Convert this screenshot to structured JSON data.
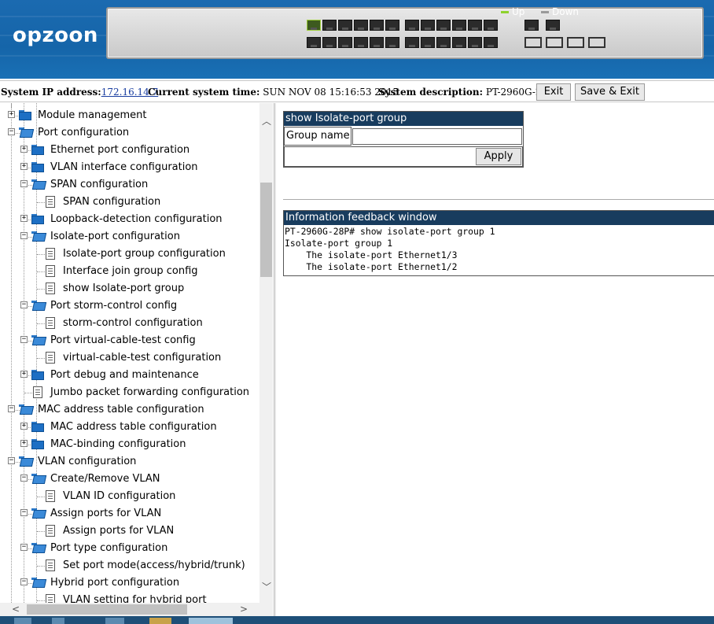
{
  "banner": {
    "logo": "opzoon",
    "legend_up": "Up",
    "legend_down": "Down",
    "up_color": "#8ed22c",
    "down_color": "#9a9a9a"
  },
  "infobar": {
    "ip_label": "System IP address:",
    "ip_value": "172.16.14.7",
    "time_label": "Current system time:",
    "time_value": "SUN NOV 08 15:16:53 2015",
    "desc_label": "System description:",
    "desc_value": "PT-2960G-28P",
    "exit_label": "Exit",
    "save_exit_label": "Save & Exit"
  },
  "tree": {
    "items": [
      {
        "label": "Module management",
        "level": 0,
        "type": "folder",
        "state": "collapsed"
      },
      {
        "label": "Port configuration",
        "level": 0,
        "type": "folder",
        "state": "expanded"
      },
      {
        "label": "Ethernet port configuration",
        "level": 1,
        "type": "folder",
        "state": "collapsed"
      },
      {
        "label": "VLAN interface configuration",
        "level": 1,
        "type": "folder",
        "state": "collapsed"
      },
      {
        "label": "SPAN configuration",
        "level": 1,
        "type": "folder",
        "state": "expanded"
      },
      {
        "label": "SPAN configuration",
        "level": 2,
        "type": "page"
      },
      {
        "label": "Loopback-detection configuration",
        "level": 1,
        "type": "folder",
        "state": "collapsed"
      },
      {
        "label": "Isolate-port configuration",
        "level": 1,
        "type": "folder",
        "state": "expanded"
      },
      {
        "label": "Isolate-port group configuration",
        "level": 2,
        "type": "page"
      },
      {
        "label": "Interface join group config",
        "level": 2,
        "type": "page"
      },
      {
        "label": "show Isolate-port group",
        "level": 2,
        "type": "page"
      },
      {
        "label": "Port storm-control config",
        "level": 1,
        "type": "folder",
        "state": "expanded"
      },
      {
        "label": "storm-control configuration",
        "level": 2,
        "type": "page"
      },
      {
        "label": "Port virtual-cable-test config",
        "level": 1,
        "type": "folder",
        "state": "expanded"
      },
      {
        "label": "virtual-cable-test configuration",
        "level": 2,
        "type": "page"
      },
      {
        "label": "Port debug and maintenance",
        "level": 1,
        "type": "folder",
        "state": "collapsed"
      },
      {
        "label": "Jumbo packet forwarding configuration",
        "level": 1,
        "type": "page"
      },
      {
        "label": "MAC address table configuration",
        "level": 0,
        "type": "folder",
        "state": "expanded"
      },
      {
        "label": "MAC address table configuration",
        "level": 1,
        "type": "folder",
        "state": "collapsed"
      },
      {
        "label": "MAC-binding configuration",
        "level": 1,
        "type": "folder",
        "state": "collapsed"
      },
      {
        "label": "VLAN configuration",
        "level": 0,
        "type": "folder",
        "state": "expanded"
      },
      {
        "label": "Create/Remove VLAN",
        "level": 1,
        "type": "folder",
        "state": "expanded"
      },
      {
        "label": "VLAN ID configuration",
        "level": 2,
        "type": "page"
      },
      {
        "label": "Assign ports for VLAN",
        "level": 1,
        "type": "folder",
        "state": "expanded"
      },
      {
        "label": "Assign ports for VLAN",
        "level": 2,
        "type": "page"
      },
      {
        "label": "Port type configuration",
        "level": 1,
        "type": "folder",
        "state": "expanded"
      },
      {
        "label": "Set port mode(access/hybrid/trunk)",
        "level": 2,
        "type": "page"
      },
      {
        "label": "Hybrid port configuration",
        "level": 1,
        "type": "folder",
        "state": "expanded"
      },
      {
        "label": "VLAN setting for hybrid port",
        "level": 2,
        "type": "page"
      }
    ]
  },
  "form": {
    "title": "show Isolate-port group",
    "group_name_label": "Group name",
    "group_name_value": "",
    "apply_label": "Apply"
  },
  "feedback": {
    "title": "Information feedback window",
    "text": "PT-2960G-28P# show isolate-port group 1\nIsolate-port group 1\n    The isolate-port Ethernet1/3\n    The isolate-port Ethernet1/2"
  }
}
